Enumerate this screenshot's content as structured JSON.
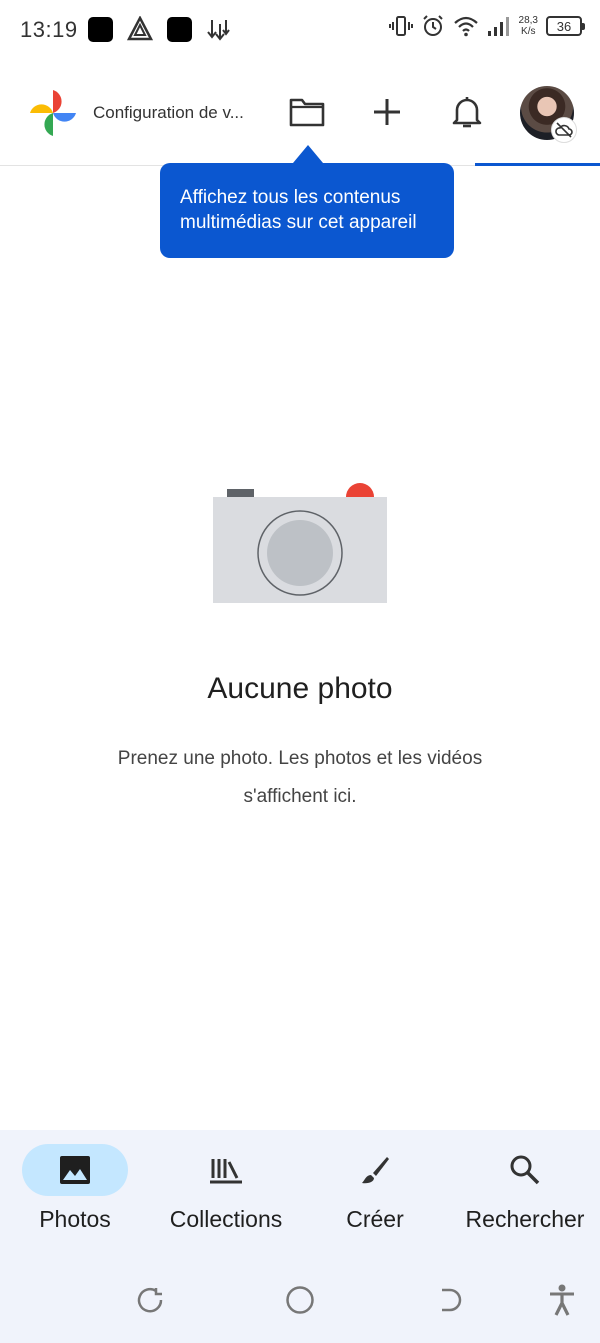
{
  "status_bar": {
    "time": "13:19",
    "net_speed_value": "28,3",
    "net_speed_unit": "K/s",
    "battery": "36"
  },
  "app_bar": {
    "title": "Configuration de v..."
  },
  "tooltip": {
    "text": "Affichez tous les contenus multimédias sur cet appareil"
  },
  "empty_state": {
    "title": "Aucune photo",
    "description": "Prenez une photo. Les photos et les vidéos s'affichent ici."
  },
  "bottom_nav": {
    "items": [
      {
        "label": "Photos",
        "icon": "photo-icon",
        "active": true
      },
      {
        "label": "Collections",
        "icon": "collections-icon",
        "active": false
      },
      {
        "label": "Créer",
        "icon": "brush-icon",
        "active": false
      },
      {
        "label": "Rechercher",
        "icon": "search-icon",
        "active": false
      }
    ]
  },
  "colors": {
    "accent": "#0b57d0",
    "active_pill": "#c4e7ff",
    "nav_background": "#f0f3fb"
  }
}
